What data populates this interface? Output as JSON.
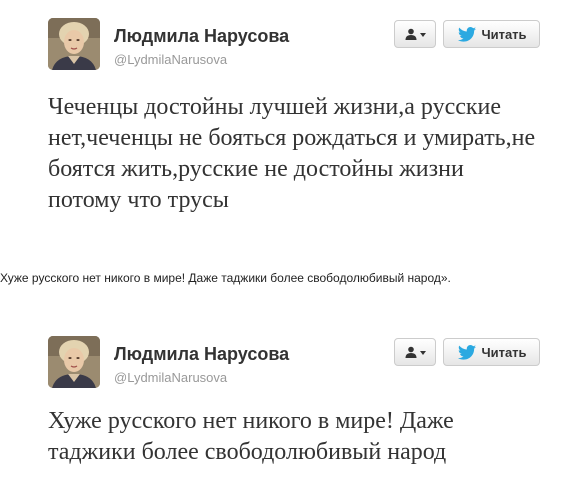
{
  "tweets": [
    {
      "user_name": "Людмила Нарусова",
      "user_handle": "@LydmilaNarusova",
      "follow_label": "Читать",
      "text": "Чеченцы достойны лучшей жизни,а русские нет,чеченцы не бояться рождаться и умирать,не боятся жить,русские не достойны жизни потому что трусы"
    },
    {
      "user_name": "Людмила Нарусова",
      "user_handle": "@LydmilaNarusova",
      "follow_label": "Читать",
      "text": "Хуже русского нет никого в мире! Даже таджики более свободолюбивый народ"
    }
  ],
  "caption": "Хуже русского нет никого в мире! Даже таджики более свободолюбивый народ».",
  "colors": {
    "name": "#333333",
    "handle": "#999999",
    "twitter_blue": "#2ba9e1",
    "text": "#333333"
  },
  "icons": [
    "user-menu-icon",
    "twitter-bird-icon"
  ]
}
